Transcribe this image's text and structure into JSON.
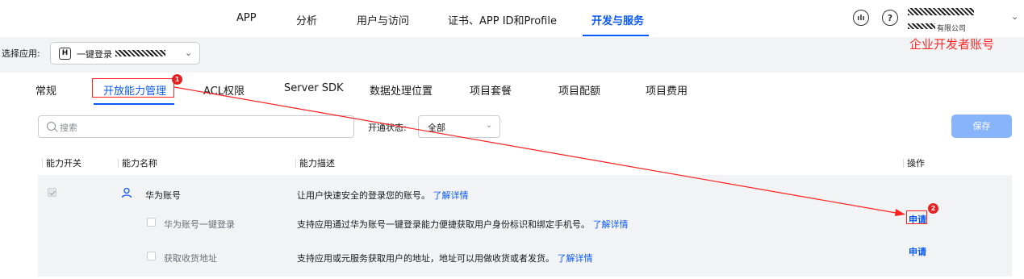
{
  "topnav": {
    "items": [
      {
        "label": "APP",
        "active": false
      },
      {
        "label": "分析",
        "active": false
      },
      {
        "label": "用户与访问",
        "active": false
      },
      {
        "label": "证书、APP ID和Profile",
        "active": false
      },
      {
        "label": "开发与服务",
        "active": true
      }
    ],
    "icons": {
      "feedback": "feedback-icon",
      "help": "?"
    },
    "account_suffix": "有限公司",
    "annotation_label": "企业开发者账号"
  },
  "app_selector": {
    "label": "选择应用:",
    "badge": "H",
    "app_name": "一键登录"
  },
  "tabs": [
    {
      "label": "常规",
      "active": false
    },
    {
      "label": "开放能力管理",
      "active": true
    },
    {
      "label": "ACL权限",
      "active": false
    },
    {
      "label": "Server SDK",
      "active": false
    },
    {
      "label": "数据处理位置",
      "active": false
    },
    {
      "label": "项目套餐",
      "active": false
    },
    {
      "label": "项目配额",
      "active": false
    },
    {
      "label": "项目费用",
      "active": false
    }
  ],
  "filters": {
    "search_placeholder": "搜索",
    "status_label": "开通状态:",
    "status_value": "全部",
    "save_label": "保存"
  },
  "table": {
    "headers": [
      "能力开关",
      "能力名称",
      "能力描述",
      "操作"
    ],
    "rows": [
      {
        "name": "华为账号",
        "desc": "让用户快速安全的登录您的账号。",
        "link": "了解详情",
        "action": "",
        "checked": true,
        "sub": false
      },
      {
        "name": "华为账号一键登录",
        "desc": "支持应用通过华为账号一键登录能力便捷获取用户身份标识和绑定手机号。",
        "link": "了解详情",
        "action": "申请",
        "checked": false,
        "sub": true
      },
      {
        "name": "获取收货地址",
        "desc": "支持应用或元服务获取用户的地址，地址可以用做收货或者发货。",
        "link": "了解详情",
        "action": "申请",
        "checked": false,
        "sub": true
      }
    ]
  },
  "annotations": {
    "marker_1": "1",
    "marker_2": "2",
    "color": "#ff2020"
  },
  "colors": {
    "accent": "#0a59f7",
    "save_disabled": "#87b4fb",
    "annotation": "#ff2020"
  }
}
